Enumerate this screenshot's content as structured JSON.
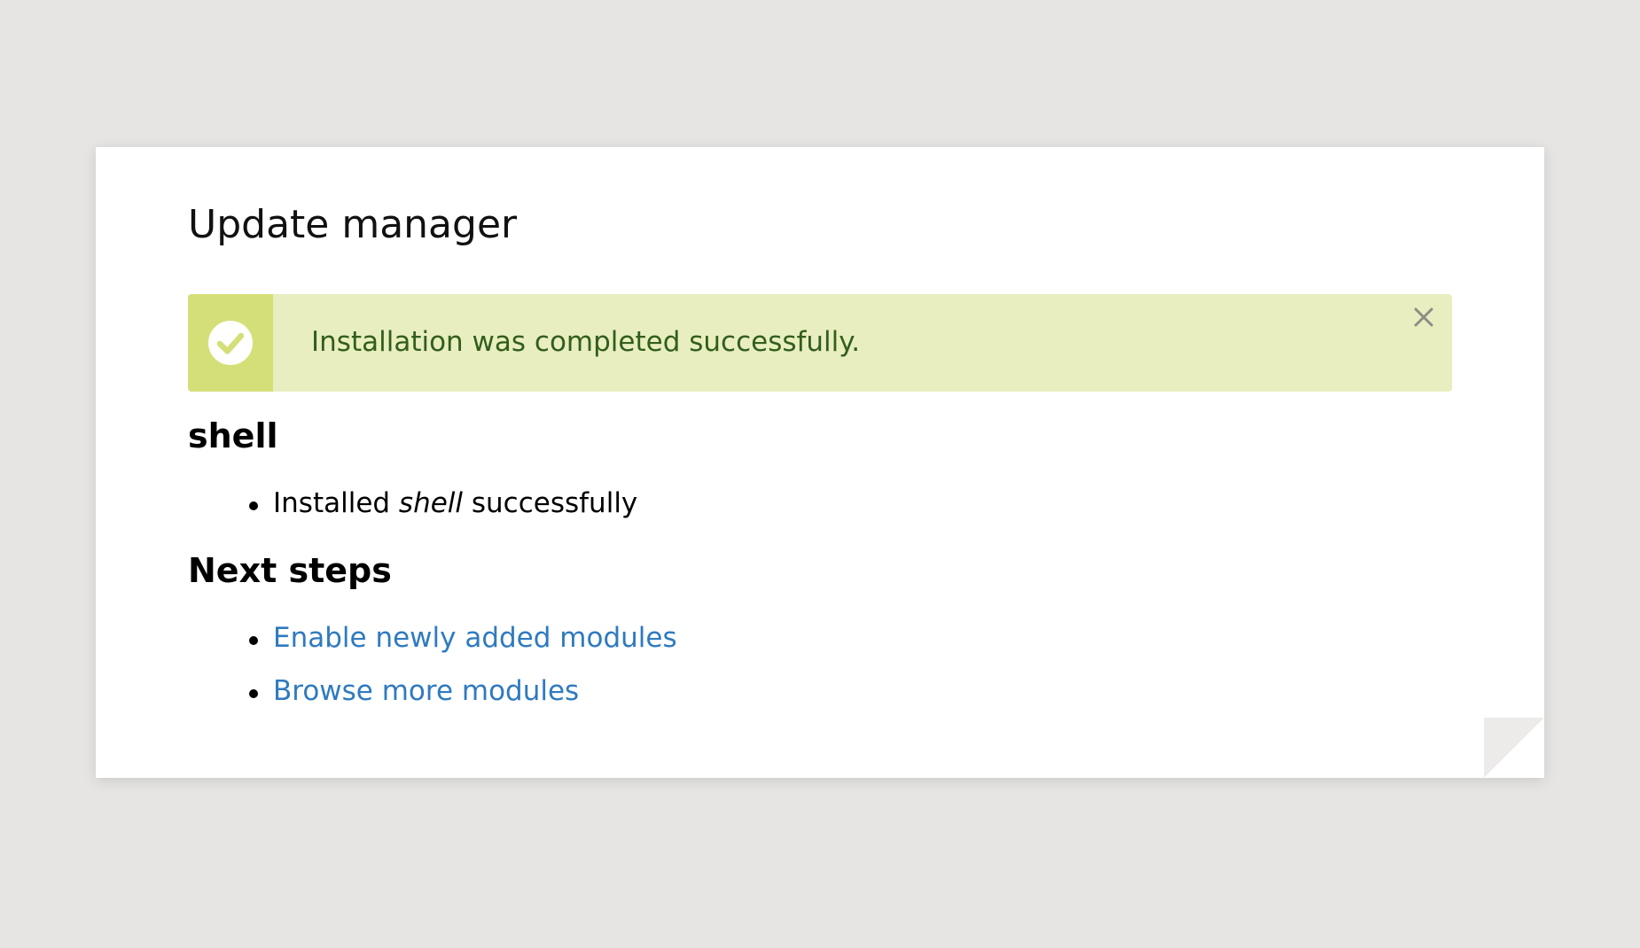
{
  "page": {
    "title": "Update manager"
  },
  "message": {
    "type": "status",
    "icon": "check-circle-icon",
    "text": "Installation was completed successfully.",
    "dismiss_icon": "close-icon",
    "colors": {
      "background": "#e8eec0",
      "icon_panel": "#d5df78",
      "text": "#325e1c"
    }
  },
  "project": {
    "name": "shell",
    "results": [
      {
        "prefix": "Installed ",
        "name": "shell",
        "suffix": " successfully"
      }
    ]
  },
  "next_steps": {
    "heading": "Next steps",
    "links": [
      {
        "label": "Enable newly added modules"
      },
      {
        "label": "Browse more modules"
      }
    ],
    "link_color": "#2f7abf"
  }
}
